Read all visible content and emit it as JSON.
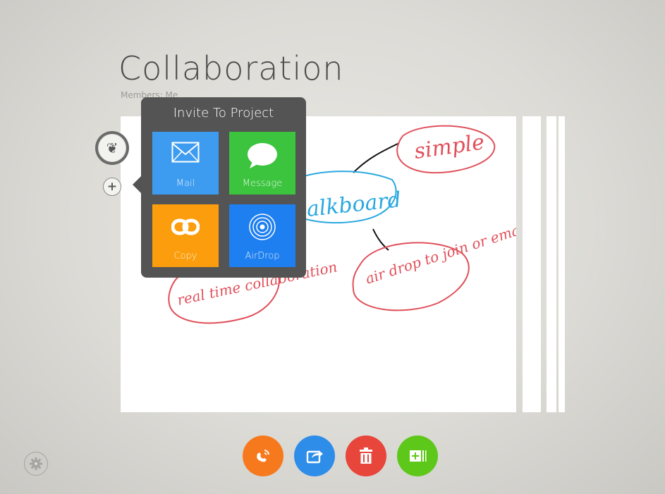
{
  "header": {
    "title": "Collaboration",
    "members_label": "Members: Me"
  },
  "invite_popover": {
    "title": "Invite To Project",
    "options": [
      {
        "label": "Mail",
        "icon": "mail-icon",
        "color": "#3e9cf0"
      },
      {
        "label": "Message",
        "icon": "message-icon",
        "color": "#3cc43f"
      },
      {
        "label": "Copy",
        "icon": "link-icon",
        "color": "#fb9d0c"
      },
      {
        "label": "AirDrop",
        "icon": "airdrop-icon",
        "color": "#1e7ff0"
      }
    ]
  },
  "whiteboard": {
    "notes": [
      "simple",
      "alkboard",
      "air drop to join or email",
      "real time collaboration"
    ]
  },
  "toolbar": {
    "buttons": [
      {
        "icon": "call-icon",
        "color": "#f7791e"
      },
      {
        "icon": "share-icon",
        "color": "#2d8de8"
      },
      {
        "icon": "trash-icon",
        "color": "#e8453b"
      },
      {
        "icon": "add-page-icon",
        "color": "#5ec81a"
      }
    ]
  },
  "settings": {
    "icon": "gear-icon"
  }
}
